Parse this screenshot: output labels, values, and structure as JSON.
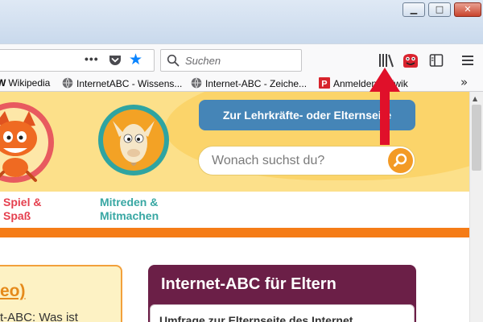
{
  "window": {
    "minimize_glyph": "▁",
    "maximize_glyph": "□",
    "close_glyph": "✕"
  },
  "toolbar": {
    "page_actions_label": "•••",
    "search_placeholder": "Suchen",
    "icons": [
      "pocket-icon",
      "bookmark-star-icon",
      "search-icon",
      "library-icon",
      "extension-icon",
      "sidebar-icon",
      "menu-icon"
    ],
    "star_color": "#0a84ff"
  },
  "bookmarks": {
    "items": [
      {
        "label": "Wikipedia",
        "favicon": "wikipedia-icon"
      },
      {
        "label": "InternetABC - Wissens...",
        "favicon": "globe-icon"
      },
      {
        "label": "Internet-ABC - Zeiche...",
        "favicon": "globe-icon"
      },
      {
        "label": "Anmelden - Piwik",
        "favicon": "piwik-icon"
      }
    ],
    "overflow_glyph": "»"
  },
  "page": {
    "nav": {
      "spiel_line1": "Spiel &",
      "spiel_line2": "Spaß",
      "mitreden_line1": "Mitreden &",
      "mitreden_line2": "Mitmachen"
    },
    "cta_label": "Zur Lehrkräfte- oder Elternseite",
    "site_search_placeholder": "Wonach suchst du?",
    "left_card": {
      "title": "eo)",
      "text": "t-ABC: Was ist"
    },
    "parents": {
      "title": "Internet-ABC für Eltern",
      "teaser": "Umfrage zur Elternseite des Internet"
    },
    "colors": {
      "header_yellow": "#fce08a",
      "orange": "#f57c17",
      "cta_blue": "#4585b7",
      "parents_purple": "#6b1f47",
      "annotation_red": "#e0102a"
    }
  }
}
